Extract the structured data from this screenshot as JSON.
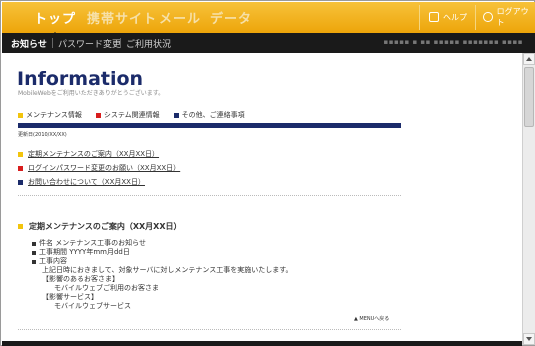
{
  "top_nav": {
    "tabs": [
      {
        "label": "トップ",
        "active": true
      },
      {
        "label": "携帯サイト",
        "active": false
      },
      {
        "label": "メール",
        "active": false
      },
      {
        "label": "データ",
        "active": false
      }
    ],
    "help_label": "ヘルプ",
    "logout_label": "ログアウト"
  },
  "sub_nav": {
    "items": [
      {
        "label": "お知らせ",
        "active": true
      },
      {
        "label": "パスワード変更",
        "active": false
      },
      {
        "label": "ご利用状況",
        "active": false
      }
    ]
  },
  "page": {
    "title": "Information",
    "subtitle": "MobileWebをご利用いただきありがとうございます。",
    "legend": [
      {
        "label": "メンテナンス情報",
        "color": "#f2c40d"
      },
      {
        "label": "システム関連情報",
        "color": "#d81d1d"
      },
      {
        "label": "その他、ご連絡事項",
        "color": "#1b2b6a"
      }
    ],
    "updated": "更新日(2010/XX/XX)",
    "news_links": [
      {
        "label": "定期メンテナンスのご案内（XX月XX日）",
        "color": "#f2c40d"
      },
      {
        "label": "ログインパスワード変更のお願い（XX月XX日）",
        "color": "#d81d1d"
      },
      {
        "label": "お問い合わせについて（XX月XX日）",
        "color": "#1b2b6a"
      }
    ],
    "section_title": "定期メンテナンスのご案内（XX月XX日）",
    "details": {
      "subject": "件名 メンテナンス工事のお知らせ",
      "period": "工事期間 YYYY年mm月dd日",
      "content_label": "工事内容",
      "content_body": "上記日時におきまして、対象サーバに対しメンテナンス工事を実施いたします。",
      "affected_customers_label": "【影響のあるお客さま】",
      "affected_customers": "モバイルウェブご利用のお客さま",
      "affected_services_label": "【影響サービス】",
      "affected_services": "モバイルウェブサービス"
    },
    "back_to_menu": "▲ MENUへ戻る"
  }
}
